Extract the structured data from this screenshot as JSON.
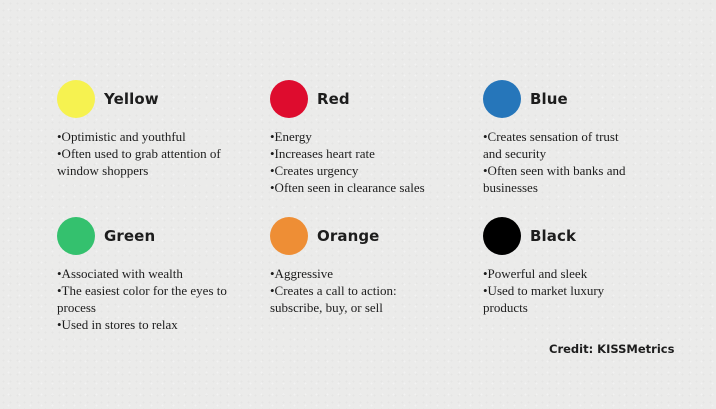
{
  "colors": [
    {
      "name": "Yellow",
      "swatch": "#f6f250",
      "bullets": [
        "•Optimistic and youthful",
        "•Often used to grab attention of window shoppers"
      ]
    },
    {
      "name": "Red",
      "swatch": "#de0c2e",
      "bullets": [
        "•Energy",
        "•Increases heart rate",
        "•Creates urgency",
        "•Often seen in clearance sales"
      ]
    },
    {
      "name": "Blue",
      "swatch": "#2676ba",
      "bullets": [
        "•Creates sensation of trust and security",
        "•Often seen with banks and businesses"
      ]
    },
    {
      "name": "Green",
      "swatch": "#34c16e",
      "bullets": [
        "•Associated with wealth",
        "•The easiest color for the eyes to process",
        "•Used in stores to relax"
      ]
    },
    {
      "name": "Orange",
      "swatch": "#ee8e35",
      "bullets": [
        "•Aggressive",
        "•Creates a call to action: subscribe, buy, or sell"
      ]
    },
    {
      "name": "Black",
      "swatch": "#000000",
      "bullets": [
        "•Powerful and sleek",
        "•Used to market luxury products"
      ]
    }
  ],
  "credit": "Credit: KISSMetrics"
}
